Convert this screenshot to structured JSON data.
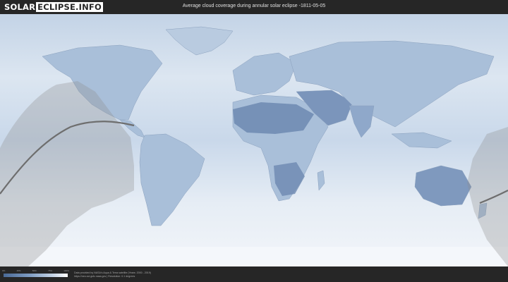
{
  "header": {
    "logo_solar": "SOLAR",
    "logo_eclipse": "ECLIPSE.INFO",
    "title": "Average cloud coverage during annular solar eclipse -1811-05-05"
  },
  "legend": {
    "ticks": [
      "0%",
      "25%",
      "50%",
      "75%",
      "100%"
    ],
    "colors": [
      "#4a6a96",
      "#7e9cc2",
      "#c2d2e4",
      "#ffffff"
    ]
  },
  "footer": {
    "credit_line1": "Data provided by NASA's Aqua & Terra satellite (Years: 2000 - 2019)",
    "credit_line2": "https://neo.sci.gsfc.nasa.gov | Resolution: 0.1 degrees"
  },
  "map": {
    "ocean_color": "#cfdceb",
    "land_color": "#a9bfd9",
    "dry_color": "#6d88b0",
    "shadow_color": "#8f8f8f",
    "path_color": "#6e6e6e"
  }
}
